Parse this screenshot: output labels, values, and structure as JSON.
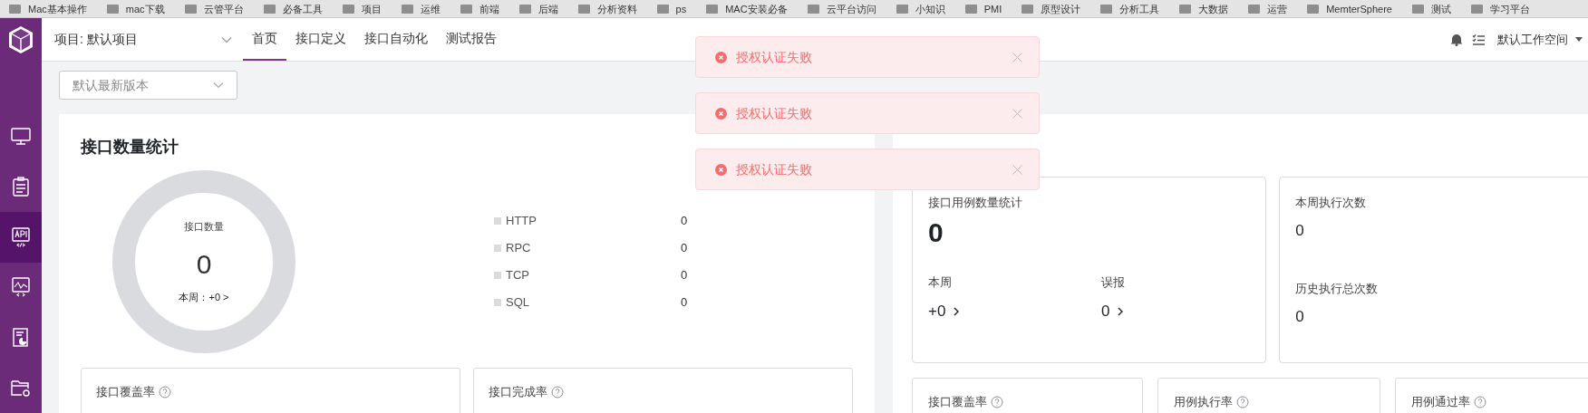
{
  "bookmarks": [
    "Mac基本操作",
    "mac下载",
    "云管平台",
    "必备工具",
    "项目",
    "运维",
    "前端",
    "后端",
    "分析资料",
    "ps",
    "MAC安装必备",
    "云平台访问",
    "小知识",
    "PMI",
    "原型设计",
    "分析工具",
    "大数据",
    "运营",
    "MemterSphere",
    "测试",
    "学习平台"
  ],
  "header": {
    "project": "项目: 默认项目",
    "tabs": [
      {
        "label": "首页",
        "selected": true
      },
      {
        "label": "接口定义",
        "selected": false
      },
      {
        "label": "接口自动化",
        "selected": false
      },
      {
        "label": "测试报告",
        "selected": false
      }
    ],
    "workspace": "默认工作空间"
  },
  "sidebar": {
    "items": [
      {
        "kind": "monitor",
        "selected": false
      },
      {
        "kind": "clipboard",
        "selected": false
      },
      {
        "kind": "api",
        "selected": true
      },
      {
        "kind": "chart",
        "selected": false
      },
      {
        "kind": "report",
        "selected": false
      },
      {
        "kind": "folder",
        "selected": false
      }
    ]
  },
  "version_select": {
    "placeholder": "默认最新版本"
  },
  "api_card": {
    "title": "接口数量统计",
    "donut": {
      "label": "接口数量",
      "value": "0",
      "week": "本周：+0 >"
    },
    "legend": [
      {
        "label": "HTTP",
        "value": "0"
      },
      {
        "label": "RPC",
        "value": "0"
      },
      {
        "label": "TCP",
        "value": "0"
      },
      {
        "label": "SQL",
        "value": "0"
      }
    ],
    "sub_cards": [
      {
        "title": "接口覆盖率"
      },
      {
        "title": "接口完成率"
      }
    ]
  },
  "case_card": {
    "stats": {
      "title": "接口用例数量统计",
      "value": "0",
      "week_label": "本周",
      "week_value": "+0",
      "false_label": "误报",
      "false_value": "0"
    },
    "exec": {
      "week_label": "本周执行次数",
      "week_value": "0",
      "total_label": "历史执行总次数",
      "total_value": "0"
    },
    "sub_cards": [
      {
        "title": "接口覆盖率"
      },
      {
        "title": "用例执行率"
      },
      {
        "title": "用例通过率"
      }
    ]
  },
  "toasts": [
    {
      "message": "授权认证失败"
    },
    {
      "message": "授权认证失败"
    },
    {
      "message": "授权认证失败"
    }
  ]
}
